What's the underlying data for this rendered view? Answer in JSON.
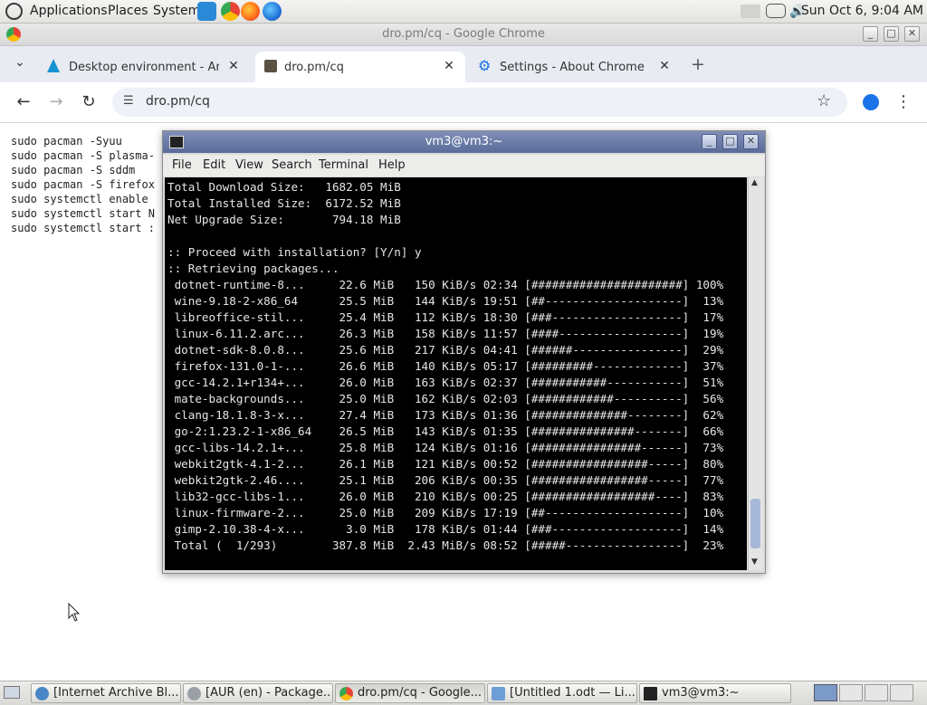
{
  "panel": {
    "menus": [
      "Applications",
      "Places",
      "System"
    ],
    "clock": "Sun Oct  6,  9:04 AM"
  },
  "chrome": {
    "window_title": "dro.pm/cq - Google Chrome",
    "tabs": [
      {
        "label": "Desktop environment - Arch",
        "active": false
      },
      {
        "label": "dro.pm/cq",
        "active": true
      },
      {
        "label": "Settings - About Chrome",
        "active": false
      }
    ],
    "url": "dro.pm/cq",
    "page_lines": "sudo pacman -Syuu\nsudo pacman -S plasma-\nsudo pacman -S sddm\nsudo pacman -S firefox\nsudo systemctl enable\nsudo systemctl start N\nsudo systemctl start :"
  },
  "terminal": {
    "title": "vm3@vm3:~",
    "menu": [
      "File",
      "Edit",
      "View",
      "Search",
      "Terminal",
      "Help"
    ],
    "output": "Total Download Size:   1682.05 MiB\nTotal Installed Size:  6172.52 MiB\nNet Upgrade Size:       794.18 MiB\n\n:: Proceed with installation? [Y/n] y\n:: Retrieving packages...\n dotnet-runtime-8...     22.6 MiB   150 KiB/s 02:34 [######################] 100%\n wine-9.18-2-x86_64      25.5 MiB   144 KiB/s 19:51 [##--------------------]  13%\n libreoffice-stil...     25.4 MiB   112 KiB/s 18:30 [###-------------------]  17%\n linux-6.11.2.arc...     26.3 MiB   158 KiB/s 11:57 [####------------------]  19%\n dotnet-sdk-8.0.8...     25.6 MiB   217 KiB/s 04:41 [######----------------]  29%\n firefox-131.0-1-...     26.6 MiB   140 KiB/s 05:17 [#########-------------]  37%\n gcc-14.2.1+r134+...     26.0 MiB   163 KiB/s 02:37 [###########-----------]  51%\n mate-backgrounds...     25.0 MiB   162 KiB/s 02:03 [############----------]  56%\n clang-18.1.8-3-x...     27.4 MiB   173 KiB/s 01:36 [##############--------]  62%\n go-2:1.23.2-1-x86_64    26.5 MiB   143 KiB/s 01:35 [###############-------]  66%\n gcc-libs-14.2.1+...     25.8 MiB   124 KiB/s 01:16 [################------]  73%\n webkit2gtk-4.1-2...     26.1 MiB   121 KiB/s 00:52 [#################-----]  80%\n webkit2gtk-2.46....     25.1 MiB   206 KiB/s 00:35 [#################-----]  77%\n lib32-gcc-libs-1...     26.0 MiB   210 KiB/s 00:25 [##################----]  83%\n linux-firmware-2...     25.0 MiB   209 KiB/s 17:19 [##--------------------]  10%\n gimp-2.10.38-4-x...      3.0 MiB   178 KiB/s 01:44 [###-------------------]  14%\n Total (  1/293)        387.8 MiB  2.43 MiB/s 08:52 [#####-----------------]  23%"
  },
  "taskbar": [
    "[Internet Archive Bl...",
    "[AUR (en) - Package...",
    "dro.pm/cq - Google...",
    "[Untitled 1.odt — Li...",
    "vm3@vm3:~"
  ],
  "colors": {
    "terminal_bg": "#000000",
    "terminal_fg": "#e6e6e6",
    "terminal_title": "#6a7ba8",
    "tabstrip": "#e8ebf2",
    "accent": "#1a73e8"
  }
}
